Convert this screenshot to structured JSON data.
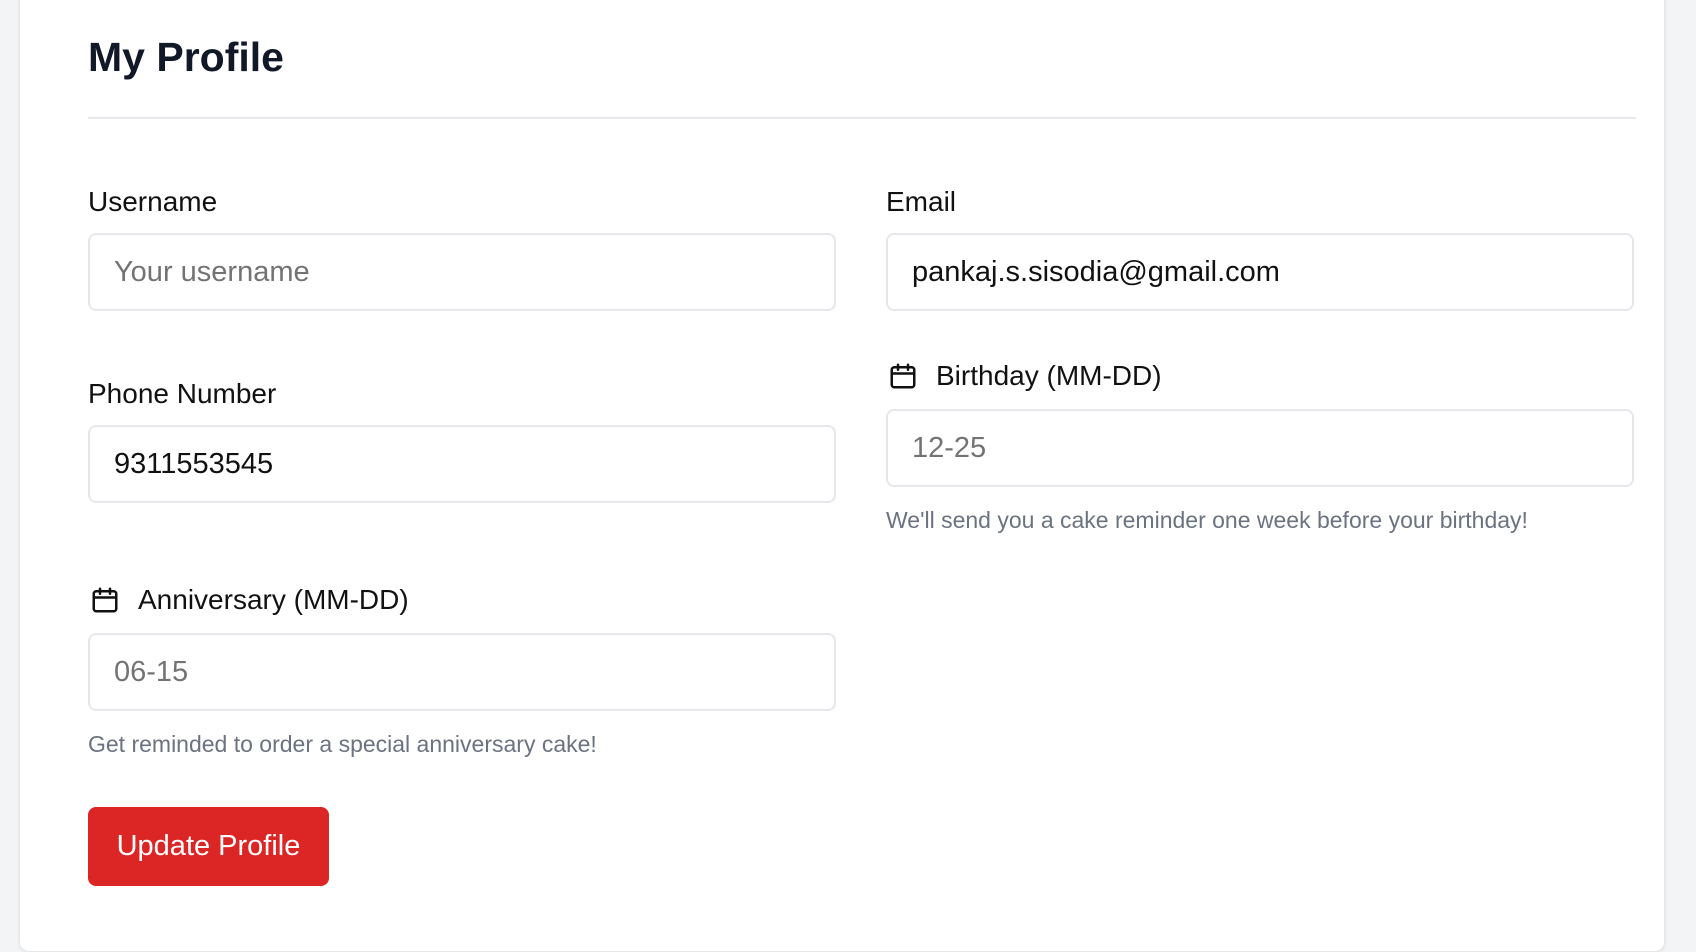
{
  "page": {
    "title": "My Profile"
  },
  "form": {
    "username": {
      "label": "Username",
      "value": "",
      "placeholder": "Your username"
    },
    "email": {
      "label": "Email",
      "value": "pankaj.s.sisodia@gmail.com",
      "placeholder": ""
    },
    "phone": {
      "label": "Phone Number",
      "value": "9311553545",
      "placeholder": ""
    },
    "birthday": {
      "label": "Birthday (MM-DD)",
      "value": "",
      "placeholder": "12-25",
      "hint": "We'll send you a cake reminder one week before your birthday!",
      "icon": "calendar-icon"
    },
    "anniversary": {
      "label": "Anniversary (MM-DD)",
      "value": "",
      "placeholder": "06-15",
      "hint": "Get reminded to order a special anniversary cake!",
      "icon": "calendar-icon"
    }
  },
  "actions": {
    "update_label": "Update Profile"
  },
  "colors": {
    "primary_button": "#dc2626",
    "hint_text": "#6b7280",
    "border": "#e5e7eb"
  }
}
